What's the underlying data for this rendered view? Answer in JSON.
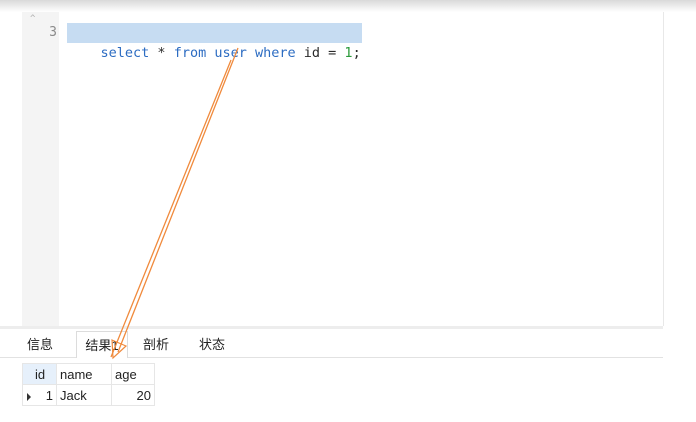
{
  "editor": {
    "fold_marker": "^",
    "line_number": "3",
    "sql_tokens": [
      {
        "text": "select",
        "kind": "keyword"
      },
      {
        "text": " * ",
        "kind": "plain"
      },
      {
        "text": "from",
        "kind": "keyword"
      },
      {
        "text": " ",
        "kind": "plain"
      },
      {
        "text": "user",
        "kind": "keyword"
      },
      {
        "text": " ",
        "kind": "plain"
      },
      {
        "text": "where",
        "kind": "keyword"
      },
      {
        "text": " id = ",
        "kind": "plain"
      },
      {
        "text": "1",
        "kind": "number"
      },
      {
        "text": ";",
        "kind": "plain"
      }
    ]
  },
  "tabs": [
    {
      "label": "信息",
      "active": false
    },
    {
      "label": "结果1",
      "active": true
    },
    {
      "label": "剖析",
      "active": false
    },
    {
      "label": "状态",
      "active": false
    }
  ],
  "results": {
    "columns": [
      "id",
      "name",
      "age"
    ],
    "rows": [
      {
        "id": "1",
        "name": "Jack",
        "age": "20"
      }
    ]
  },
  "colors": {
    "selection": "#c6dcf2",
    "keyword": "#2c6cc2",
    "number": "#2a9a3a",
    "annotation_arrow": "#f08a3c"
  }
}
